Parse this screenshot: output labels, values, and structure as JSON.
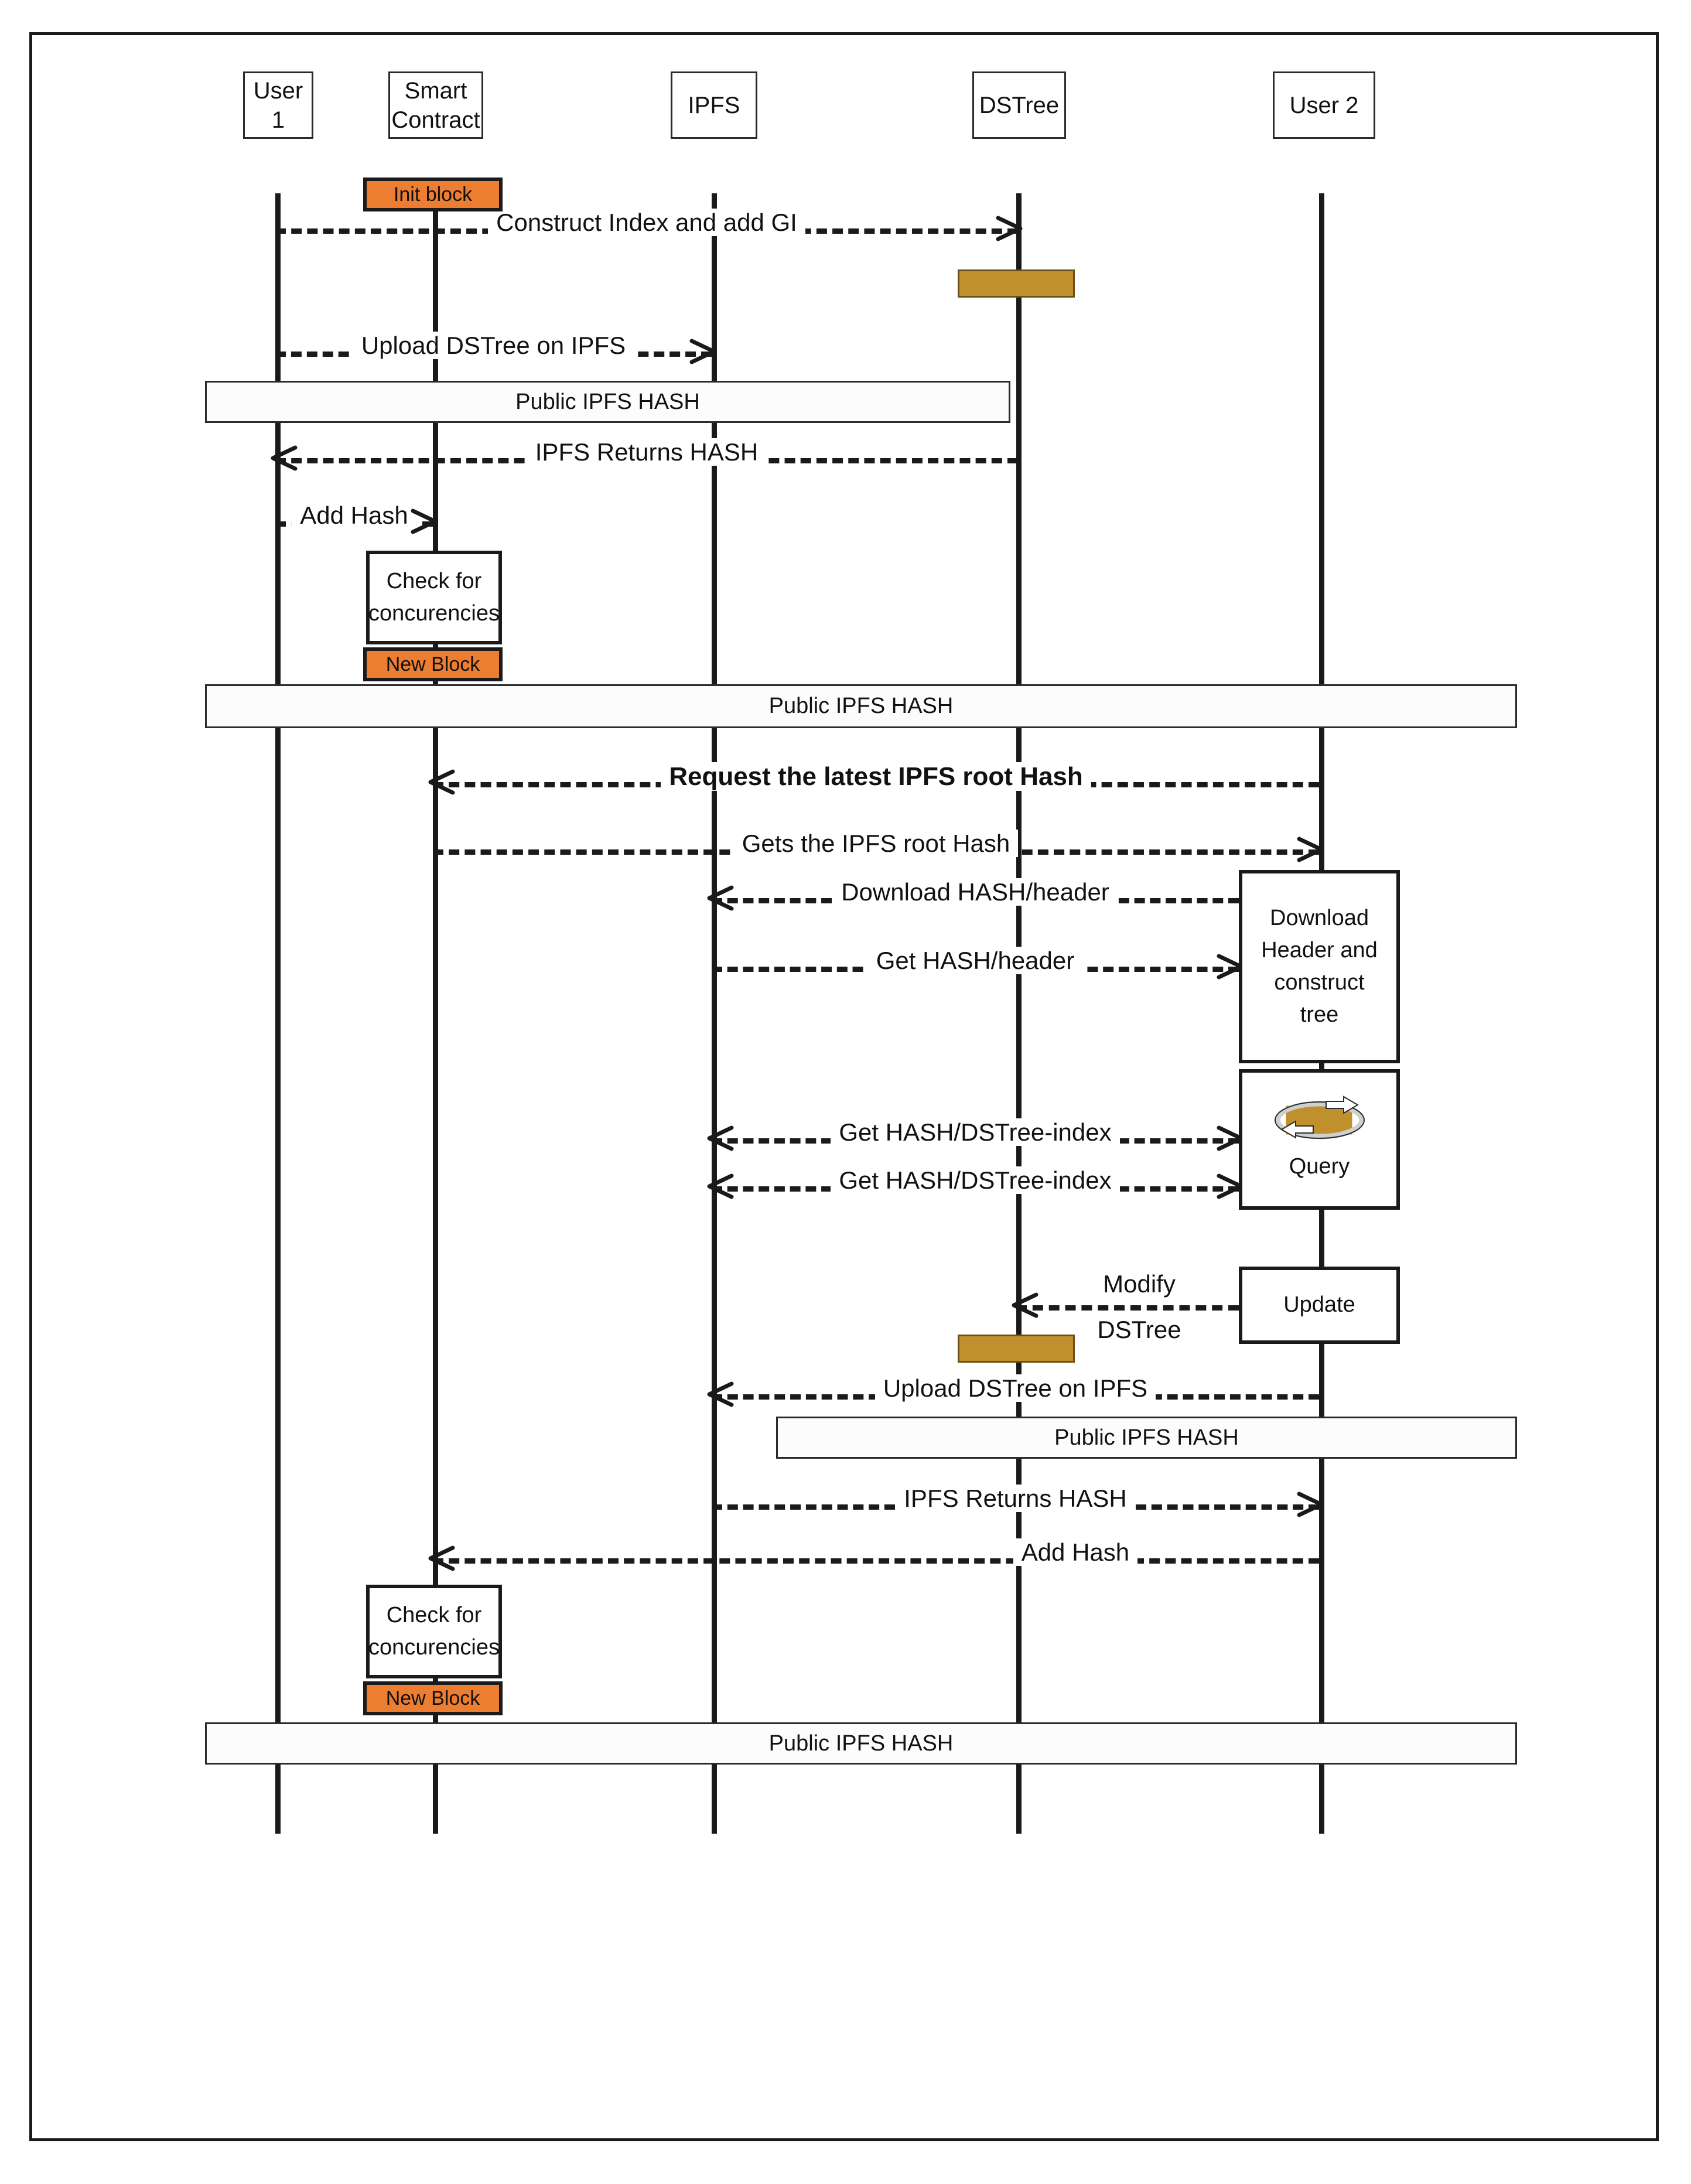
{
  "diagram": {
    "title": "DSTree IPFS Blockchain Sequence Diagram",
    "type": "uml-sequence",
    "colors": {
      "block_orange": "#ED7D31",
      "activation_gold": "#C08F2E",
      "line_black": "#1A1A1A",
      "band_fill": "#FCFCFC"
    }
  },
  "actors": [
    {
      "id": "user1",
      "label": "User 1"
    },
    {
      "id": "contract",
      "label": "Smart\nContract",
      "line1": "Smart",
      "line2": "Contract"
    },
    {
      "id": "ipfs",
      "label": "IPFS"
    },
    {
      "id": "dstree",
      "label": "DSTree"
    },
    {
      "id": "user2",
      "label": "User 2"
    }
  ],
  "blocks": [
    {
      "id": "init-block",
      "label": "Init block"
    },
    {
      "id": "new-block-1",
      "label": "New Block"
    },
    {
      "id": "new-block-2",
      "label": "New Block"
    }
  ],
  "process_boxes": [
    {
      "id": "check-concurrencies-1",
      "label": "Check for\nconcurencies",
      "line1": "Check for",
      "line2": "concurencies"
    },
    {
      "id": "check-concurrencies-2",
      "label": "Check for\nconcurencies",
      "line1": "Check for",
      "line2": "concurencies"
    },
    {
      "id": "download-header",
      "line1": "Download",
      "line2": "Header and",
      "line3": "construct",
      "line4": "tree"
    },
    {
      "id": "query",
      "label": "Query"
    },
    {
      "id": "update",
      "label": "Update"
    }
  ],
  "hash_bands": [
    {
      "id": "public-hash-1",
      "label": "Public IPFS HASH"
    },
    {
      "id": "public-hash-2",
      "label": "Public IPFS HASH"
    },
    {
      "id": "public-hash-3",
      "label": "Public IPFS HASH"
    },
    {
      "id": "public-hash-4",
      "label": "Public IPFS HASH"
    }
  ],
  "messages": [
    {
      "id": "m1",
      "label": "Construct Index and add GI",
      "from": "user1",
      "to": "dstree"
    },
    {
      "id": "m2",
      "label": "Upload DSTree on IPFS",
      "from": "user1",
      "to": "ipfs"
    },
    {
      "id": "m3",
      "label": "IPFS Returns HASH",
      "from": "dstree",
      "to": "user1"
    },
    {
      "id": "m4",
      "label": "Add Hash",
      "from": "user1",
      "to": "contract"
    },
    {
      "id": "m5",
      "label": "Request the latest IPFS root Hash",
      "from": "user2",
      "to": "contract",
      "bold": true
    },
    {
      "id": "m6",
      "label": "Gets the IPFS root Hash",
      "from": "contract",
      "to": "user2"
    },
    {
      "id": "m7",
      "label": "Download HASH/header",
      "from": "user2",
      "to": "ipfs"
    },
    {
      "id": "m8",
      "label": "Get HASH/header",
      "from": "ipfs",
      "to": "user2"
    },
    {
      "id": "m9",
      "label": "Get HASH/DSTree-index",
      "from": "user2",
      "to": "ipfs"
    },
    {
      "id": "m10",
      "label": "Get HASH/DSTree-index",
      "from": "user2",
      "to": "ipfs"
    },
    {
      "id": "m11",
      "label": "Modify DSTree",
      "line1": "Modify",
      "line2": "DSTree",
      "from": "user2",
      "to": "dstree"
    },
    {
      "id": "m12",
      "label": "Upload DSTree on IPFS",
      "from": "user2",
      "to": "ipfs"
    },
    {
      "id": "m13",
      "label": "IPFS Returns HASH",
      "from": "ipfs",
      "to": "user2"
    },
    {
      "id": "m14",
      "label": "Add Hash",
      "from": "user2",
      "to": "contract"
    }
  ],
  "icons": {
    "query": "query-refresh-icon"
  }
}
